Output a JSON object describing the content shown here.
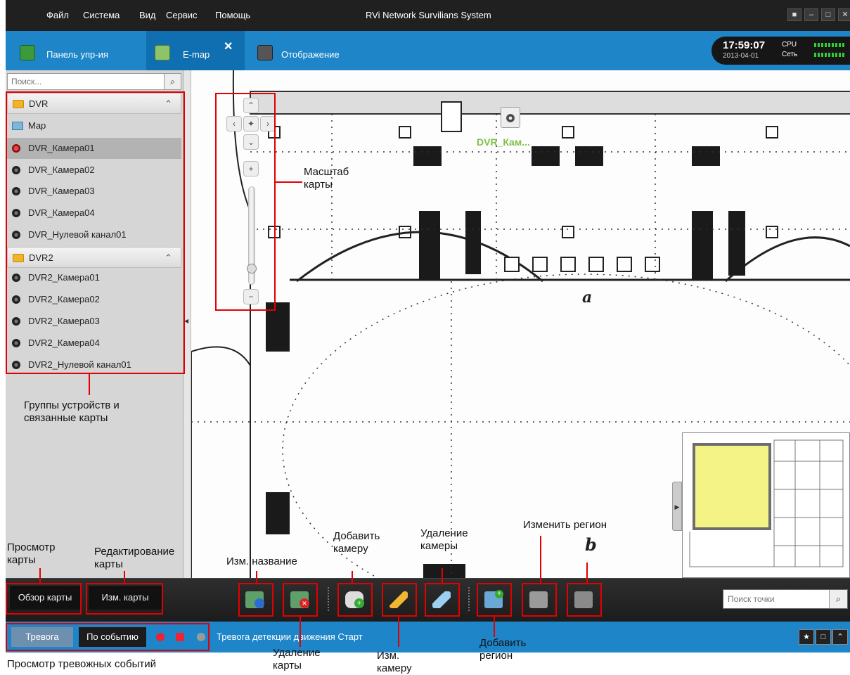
{
  "menubar": {
    "items": [
      "Файл",
      "Система",
      "Вид",
      "Сервис",
      "Помощь"
    ],
    "title": "RVi Network Survilians System"
  },
  "tabs": {
    "panel": "Панель упр-ия",
    "emap": "E-map",
    "display": "Отображение"
  },
  "status": {
    "time": "17:59:07",
    "date": "2013-04-01",
    "cpu": "CPU",
    "net": "Сеть"
  },
  "sidebar": {
    "search_placeholder": "Поиск...",
    "groups": [
      {
        "name": "DVR",
        "items": [
          "Map",
          "DVR_Камера01",
          "DVR_Камера02",
          "DVR_Камера03",
          "DVR_Камера04",
          "DVR_Нулевой канал01"
        ]
      },
      {
        "name": "DVR2",
        "items": [
          "DVR2_Камера01",
          "DVR2_Камера02",
          "DVR2_Камера03",
          "DVR2_Камера04",
          "DVR2_Нулевой канал01"
        ]
      }
    ]
  },
  "map": {
    "camera_label": "DVR_Кам...",
    "mark_a": "a",
    "mark_b": "b"
  },
  "toolbar": {
    "view_map": "Обзор карты",
    "edit_map": "Изм. карты",
    "point_search_placeholder": "Поиск точки"
  },
  "alarmbar": {
    "tab_alarm": "Тревога",
    "tab_event": "По событию",
    "message": "Тревога детекции движения Старт"
  },
  "annotations": {
    "map_scale": "Масштаб\nкарты",
    "device_groups": "Группы устройств и\nсвязанные карты",
    "view_map": "Просмотр\nкарты",
    "edit_map": "Редактирование\nкарты",
    "rename": "Изм. название",
    "add_camera": "Добавить\nкамеру",
    "delete_camera": "Удаление\nкамеры",
    "change_region": "Изменить регион",
    "delete_map": "Удаление\nкарты",
    "edit_camera": "Изм.\nкамеру",
    "add_region": "Добавить\nрегион",
    "alarm_view": "Просмотр тревожных событий"
  },
  "colors": {
    "accent": "#1e85c8",
    "annotation_red": "#e20000",
    "camera_label": "#7fc04a",
    "minimap_view": "#f4f480"
  }
}
